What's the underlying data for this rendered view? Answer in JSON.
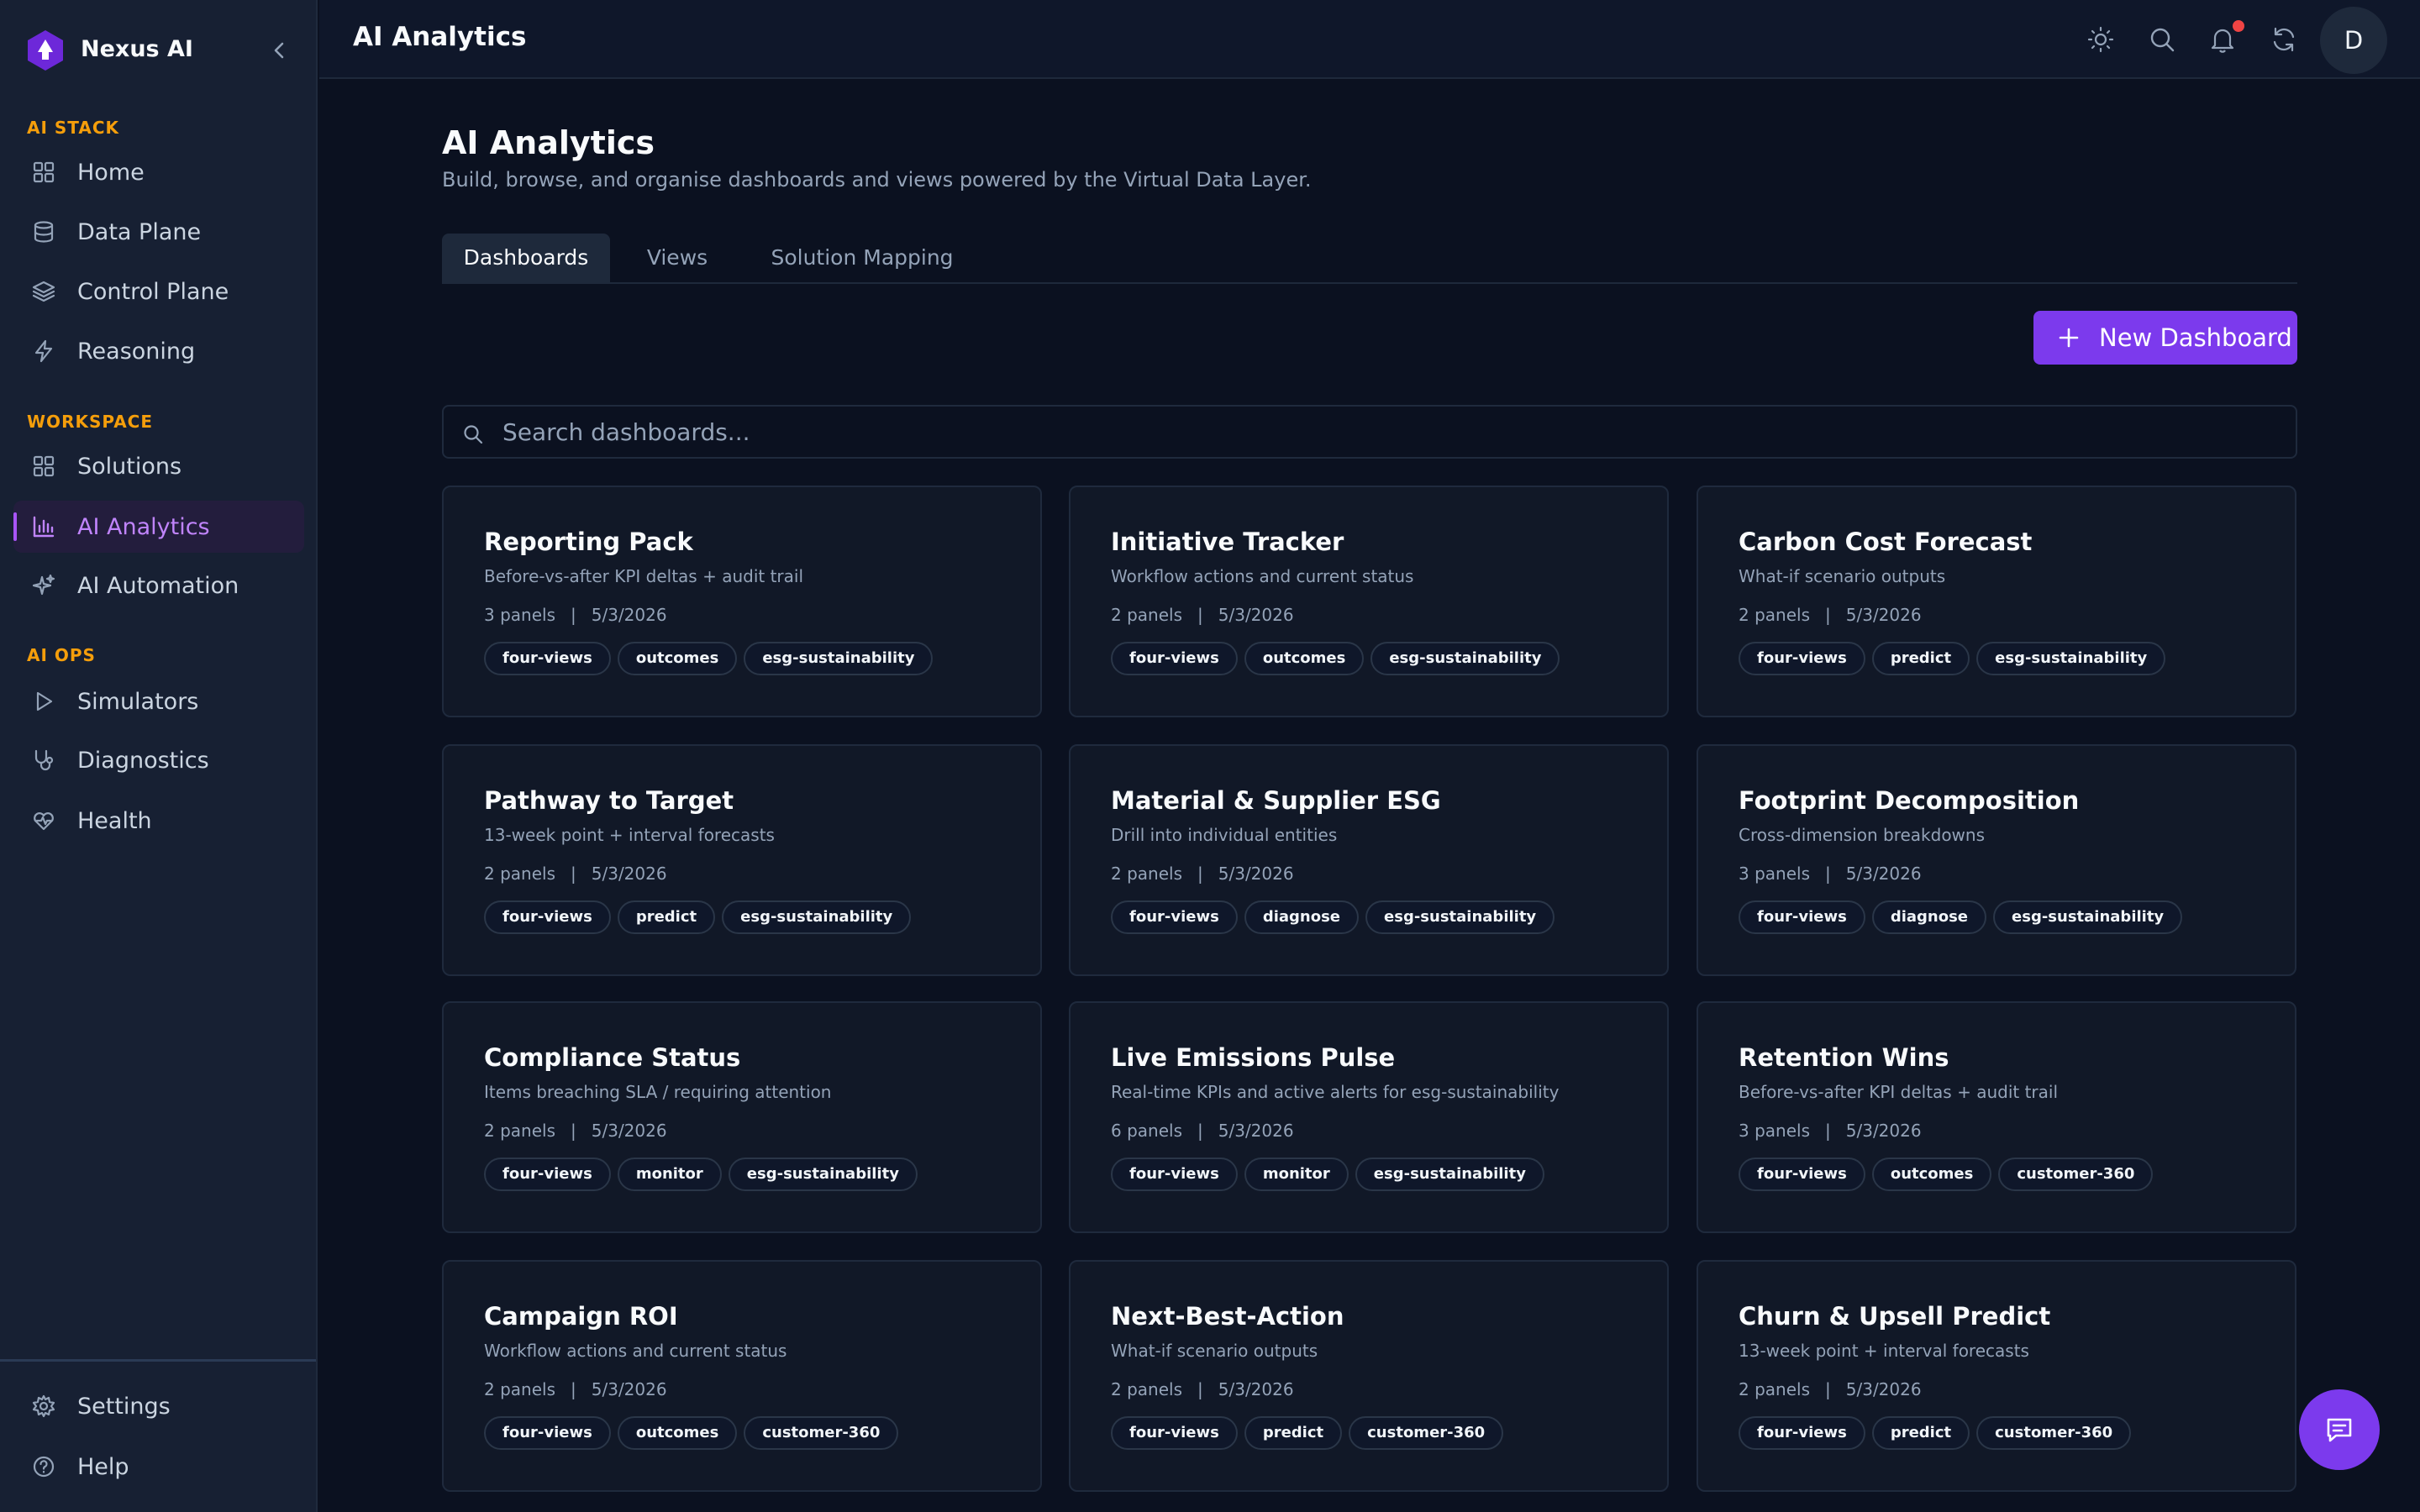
{
  "sidebar": {
    "brand": "Nexus AI",
    "sections": [
      {
        "label": "AI STACK",
        "items": [
          {
            "label": "Home",
            "icon": "grid-icon"
          },
          {
            "label": "Data Plane",
            "icon": "database-icon"
          },
          {
            "label": "Control Plane",
            "icon": "layers-icon"
          },
          {
            "label": "Reasoning",
            "icon": "bolt-icon"
          }
        ]
      },
      {
        "label": "WORKSPACE",
        "items": [
          {
            "label": "Solutions",
            "icon": "grid-icon"
          },
          {
            "label": "AI Analytics",
            "icon": "bar-chart-icon",
            "active": true
          },
          {
            "label": "AI Automation",
            "icon": "sparkles-icon"
          }
        ]
      },
      {
        "label": "AI OPS",
        "items": [
          {
            "label": "Simulators",
            "icon": "play-icon"
          },
          {
            "label": "Diagnostics",
            "icon": "stethoscope-icon"
          },
          {
            "label": "Health",
            "icon": "heart-pulse-icon"
          }
        ]
      }
    ],
    "footer": [
      {
        "label": "Settings",
        "icon": "gear-icon"
      },
      {
        "label": "Help",
        "icon": "help-circle-icon"
      }
    ]
  },
  "topbar": {
    "title": "AI Analytics",
    "avatar_initial": "D"
  },
  "page": {
    "title": "AI Analytics",
    "subtitle": "Build, browse, and organise dashboards and views powered by the Virtual Data Layer.",
    "tabs": [
      {
        "label": "Dashboards",
        "active": true
      },
      {
        "label": "Views"
      },
      {
        "label": "Solution Mapping"
      }
    ],
    "new_button": "New Dashboard",
    "search_placeholder": "Search dashboards..."
  },
  "dashboards": [
    {
      "title": "Reporting Pack",
      "desc": "Before-vs-after KPI deltas + audit trail",
      "panels": "3 panels",
      "date": "5/3/2026",
      "tags": [
        "four-views",
        "outcomes",
        "esg-sustainability"
      ]
    },
    {
      "title": "Initiative Tracker",
      "desc": "Workflow actions and current status",
      "panels": "2 panels",
      "date": "5/3/2026",
      "tags": [
        "four-views",
        "outcomes",
        "esg-sustainability"
      ]
    },
    {
      "title": "Carbon Cost Forecast",
      "desc": "What-if scenario outputs",
      "panels": "2 panels",
      "date": "5/3/2026",
      "tags": [
        "four-views",
        "predict",
        "esg-sustainability"
      ]
    },
    {
      "title": "Pathway to Target",
      "desc": "13-week point + interval forecasts",
      "panels": "2 panels",
      "date": "5/3/2026",
      "tags": [
        "four-views",
        "predict",
        "esg-sustainability"
      ]
    },
    {
      "title": "Material & Supplier ESG",
      "desc": "Drill into individual entities",
      "panels": "2 panels",
      "date": "5/3/2026",
      "tags": [
        "four-views",
        "diagnose",
        "esg-sustainability"
      ]
    },
    {
      "title": "Footprint Decomposition",
      "desc": "Cross-dimension breakdowns",
      "panels": "3 panels",
      "date": "5/3/2026",
      "tags": [
        "four-views",
        "diagnose",
        "esg-sustainability"
      ]
    },
    {
      "title": "Compliance Status",
      "desc": "Items breaching SLA / requiring attention",
      "panels": "2 panels",
      "date": "5/3/2026",
      "tags": [
        "four-views",
        "monitor",
        "esg-sustainability"
      ]
    },
    {
      "title": "Live Emissions Pulse",
      "desc": "Real-time KPIs and active alerts for esg-sustainability",
      "panels": "6 panels",
      "date": "5/3/2026",
      "tags": [
        "four-views",
        "monitor",
        "esg-sustainability"
      ]
    },
    {
      "title": "Retention Wins",
      "desc": "Before-vs-after KPI deltas + audit trail",
      "panels": "3 panels",
      "date": "5/3/2026",
      "tags": [
        "four-views",
        "outcomes",
        "customer-360"
      ]
    },
    {
      "title": "Campaign ROI",
      "desc": "Workflow actions and current status",
      "panels": "2 panels",
      "date": "5/3/2026",
      "tags": [
        "four-views",
        "outcomes",
        "customer-360"
      ]
    },
    {
      "title": "Next-Best-Action",
      "desc": "What-if scenario outputs",
      "panels": "2 panels",
      "date": "5/3/2026",
      "tags": [
        "four-views",
        "predict",
        "customer-360"
      ]
    },
    {
      "title": "Churn & Upsell Predict",
      "desc": "13-week point + interval forecasts",
      "panels": "2 panels",
      "date": "5/3/2026",
      "tags": [
        "four-views",
        "predict",
        "customer-360"
      ]
    }
  ],
  "colors": {
    "accent": "#7c3aed",
    "section_label": "#f59e0b",
    "notification": "#ef4444"
  }
}
